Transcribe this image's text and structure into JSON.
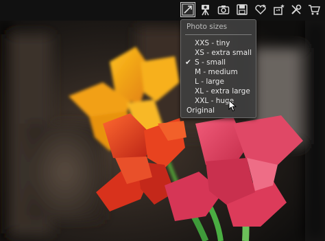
{
  "toolbar": {
    "tools": [
      {
        "icon": "resize-icon",
        "active": true
      },
      {
        "icon": "camera-tripod-icon",
        "active": false
      },
      {
        "icon": "camera-icon",
        "active": false
      },
      {
        "icon": "save-icon",
        "active": false
      },
      {
        "icon": "favorite-heart-icon",
        "active": false
      },
      {
        "icon": "share-icon",
        "active": false
      },
      {
        "icon": "tools-icon",
        "active": false
      },
      {
        "icon": "shopping-cart-icon",
        "active": false
      }
    ]
  },
  "menu": {
    "header": "Photo sizes",
    "items": [
      {
        "label": "XXS - tiny",
        "check": ""
      },
      {
        "label": "XS - extra small",
        "check": ""
      },
      {
        "label": "S - small",
        "check": "✔"
      },
      {
        "label": "M - medium",
        "check": ""
      },
      {
        "label": "L - large",
        "check": ""
      },
      {
        "label": "XL - extra large",
        "check": ""
      },
      {
        "label": "XXL - huge",
        "check": ""
      }
    ],
    "original": "Original",
    "selected_index": 2
  },
  "colors": {
    "menu_bg": "#3e3e3e",
    "menu_text": "#e9e9e9",
    "header_text": "#bdbdbd",
    "orange_petal": "#f2a018",
    "red_petal": "#d8321c",
    "pink_petal": "#dc3b5a",
    "stem_green": "#3f9a3a"
  }
}
